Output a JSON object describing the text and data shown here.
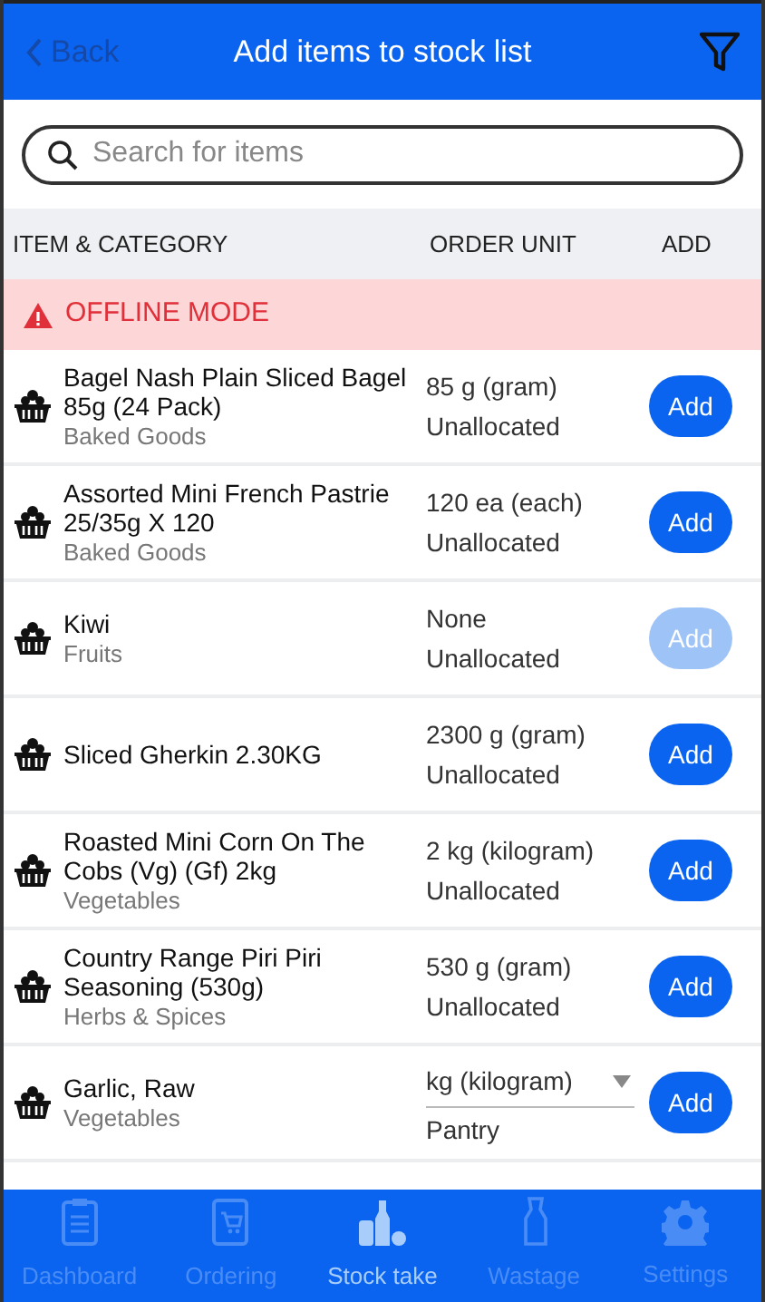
{
  "header": {
    "back": {
      "label": "Back",
      "disabled": true
    },
    "title": "Add items to stock list"
  },
  "search": {
    "placeholder": "Search for items"
  },
  "table": {
    "columns": [
      "ITEM & CATEGORY",
      "ORDER UNIT",
      "ADD"
    ],
    "banner": "OFFLINE MODE",
    "rows": [
      {
        "name": "Bagel Nash Plain Sliced Bagel 85g (24 Pack)",
        "category": "Baked Goods",
        "kind": "text",
        "unit": "85 g (gram)",
        "location": "Unallocated",
        "button": "Add",
        "disabled": false
      },
      {
        "name": "Assorted Mini French Pastrie 25/35g X 120",
        "category": "Baked Goods",
        "kind": "text",
        "unit": "120 ea (each)",
        "location": "Unallocated",
        "button": "Add",
        "disabled": false
      },
      {
        "name": "Kiwi",
        "category": "Fruits",
        "kind": "text",
        "unit": "None",
        "location": "Unallocated",
        "button": "Add",
        "disabled": true
      },
      {
        "name": "Sliced Gherkin 2.30KG",
        "kind": "text",
        "unit": "2300 g (gram)",
        "location": "Unallocated",
        "button": "Add",
        "disabled": false
      },
      {
        "name": "Roasted Mini Corn On The Cobs (Vg) (Gf) 2kg",
        "category": "Vegetables",
        "kind": "text",
        "unit": "2 kg (kilogram)",
        "location": "Unallocated",
        "button": "Add",
        "disabled": false
      },
      {
        "name": "Country Range Piri Piri Seasoning (530g)",
        "category": "Herbs & Spices",
        "kind": "text",
        "unit": "530 g (gram)",
        "location": "Unallocated",
        "button": "Add",
        "disabled": false
      },
      {
        "name": "Garlic, Raw",
        "category": "Vegetables",
        "kind": "dropdown",
        "unit": "kg (kilogram)",
        "location": "Pantry",
        "button": "Add",
        "disabled": false
      }
    ]
  },
  "tab_bar": [
    {
      "label": "Dashboard",
      "selected": false
    },
    {
      "label": "Ordering",
      "selected": false
    },
    {
      "label": "Stock take",
      "selected": true
    },
    {
      "label": "Wastage",
      "selected": false
    },
    {
      "label": "Settings",
      "selected": false
    }
  ]
}
